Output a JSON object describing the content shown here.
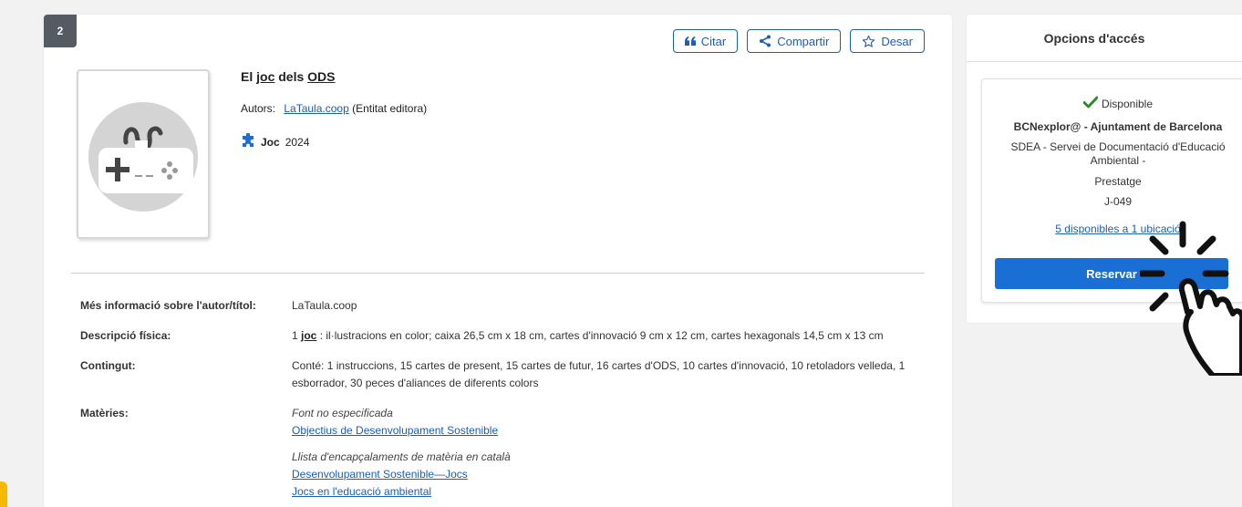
{
  "result": {
    "number": "2",
    "actions": {
      "cite": "Citar",
      "share": "Compartir",
      "save": "Desar"
    },
    "title_prefix": "El ",
    "title_link1": "joc",
    "title_mid": " dels ",
    "title_link2": "ODS",
    "authors_label": "Autors:",
    "author_name": "LaTaula.coop",
    "author_role": "(Entitat editora)",
    "type": "Joc",
    "year": "2024",
    "details": {
      "author_info_label": "Més informació sobre l'autor/títol:",
      "author_info_value": "LaTaula.coop",
      "physical_label": "Descripció física:",
      "physical_prefix": "1 ",
      "physical_link": "joc",
      "physical_value": " : il·lustracions en color; caixa 26,5 cm x 18 cm, cartes d'innovació 9 cm x 12 cm, cartes hexagonals 14,5 cm x 13 cm",
      "contents_label": "Contingut:",
      "contents_value": "Conté: 1 instruccions, 15 cartes de present, 15 cartes de futur, 16 cartes d'ODS, 10 cartes d'innovació, 10 retoladors velleda, 1 esborrador, 30 peces d'aliances de diferents colors",
      "subjects_label": "Matèries:",
      "subjects_group1_source": "Font no especificada",
      "subjects_group1_items": [
        "Objectius de Desenvolupament Sostenible"
      ],
      "subjects_group2_source": "Llista d'encapçalaments de matèria en català",
      "subjects_group2_items": [
        "Desenvolupament Sostenible—Jocs",
        "Jocs en l'educació ambiental"
      ]
    }
  },
  "access": {
    "header": "Opcions d'accés",
    "status": "Disponible",
    "library": "BCNexplor@ - Ajuntament de Barcelona",
    "location": "SDEA - Servei de Documentació d'Educació Ambiental -",
    "shelf": "Prestatge",
    "call_number": "J-049",
    "copies_link": "5 disponibles a 1 ubicació",
    "reserve_label": "Reservar"
  },
  "colors": {
    "accent": "#1a6fd4",
    "link": "#1a5fb4",
    "available": "#2e8b2e",
    "badge": "#555b63"
  }
}
